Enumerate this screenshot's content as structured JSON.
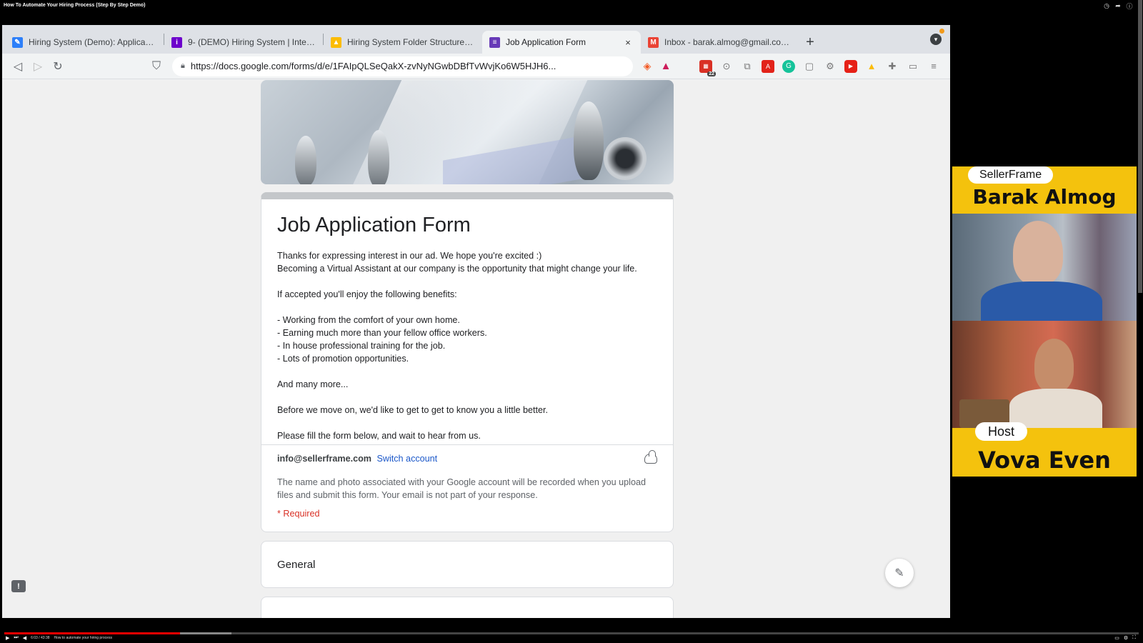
{
  "video": {
    "title": "How To Automate Your Hiring Process (Step By Step Demo)",
    "time": "6:03 / 43:38",
    "chapter": "How to automate your hiring process",
    "progress_played": 0.155,
    "progress_loaded": 0.2
  },
  "browser": {
    "tabs": [
      {
        "label": "Hiring System (Demo): Applicants",
        "icon": "airtable-icon",
        "color": "#2d7ff9",
        "active": false
      },
      {
        "label": "9- (DEMO) Hiring System | Integromat",
        "icon": "info-icon",
        "color": "#6d00cc",
        "active": false
      },
      {
        "label": "Hiring System Folder Structure - Google Drive",
        "icon": "drive-icon",
        "color": "#fbbc04",
        "active": false
      },
      {
        "label": "Job Application Form",
        "icon": "forms-icon",
        "color": "#673ab7",
        "active": true
      },
      {
        "label": "Inbox - barak.almog@gmail.com - Gmail",
        "icon": "gmail-icon",
        "color": "#ea4335",
        "active": false
      }
    ],
    "new_tab": "+",
    "close": "×",
    "url": "https://docs.google.com/forms/d/e/1FAIpQLSeQakX-zvNyNGwbDBfTvWvjKo6W5HJH6...",
    "extension_badge": "22"
  },
  "form": {
    "title": "Job Application Form",
    "description": "Thanks for expressing interest in our ad. We hope you're excited :)\nBecoming a Virtual Assistant at our company is the opportunity that might change your life.\n\nIf accepted you'll enjoy the following benefits:\n\n- Working from the comfort of your own home.\n- Earning much more than your fellow office workers.\n- In house professional training for the job.\n- Lots of promotion opportunities.\n\nAnd many more...\n\nBefore we move on, we'd like to get to get to know you a little better.\n\nPlease fill the form below, and wait to hear from us.",
    "account_email": "info@sellerframe.com",
    "switch_account": "Switch account",
    "account_note": "The name and photo associated with your Google account will be recorded when you upload files and submit this form. Your email is not part of your response.",
    "required": "* Required",
    "section_title": "General"
  },
  "overlay": {
    "guest_company": "SellerFrame",
    "guest_name": "Barak Almog",
    "host_label": "Host",
    "host_name": "Vova Even",
    "accent": "#f4c20d"
  }
}
